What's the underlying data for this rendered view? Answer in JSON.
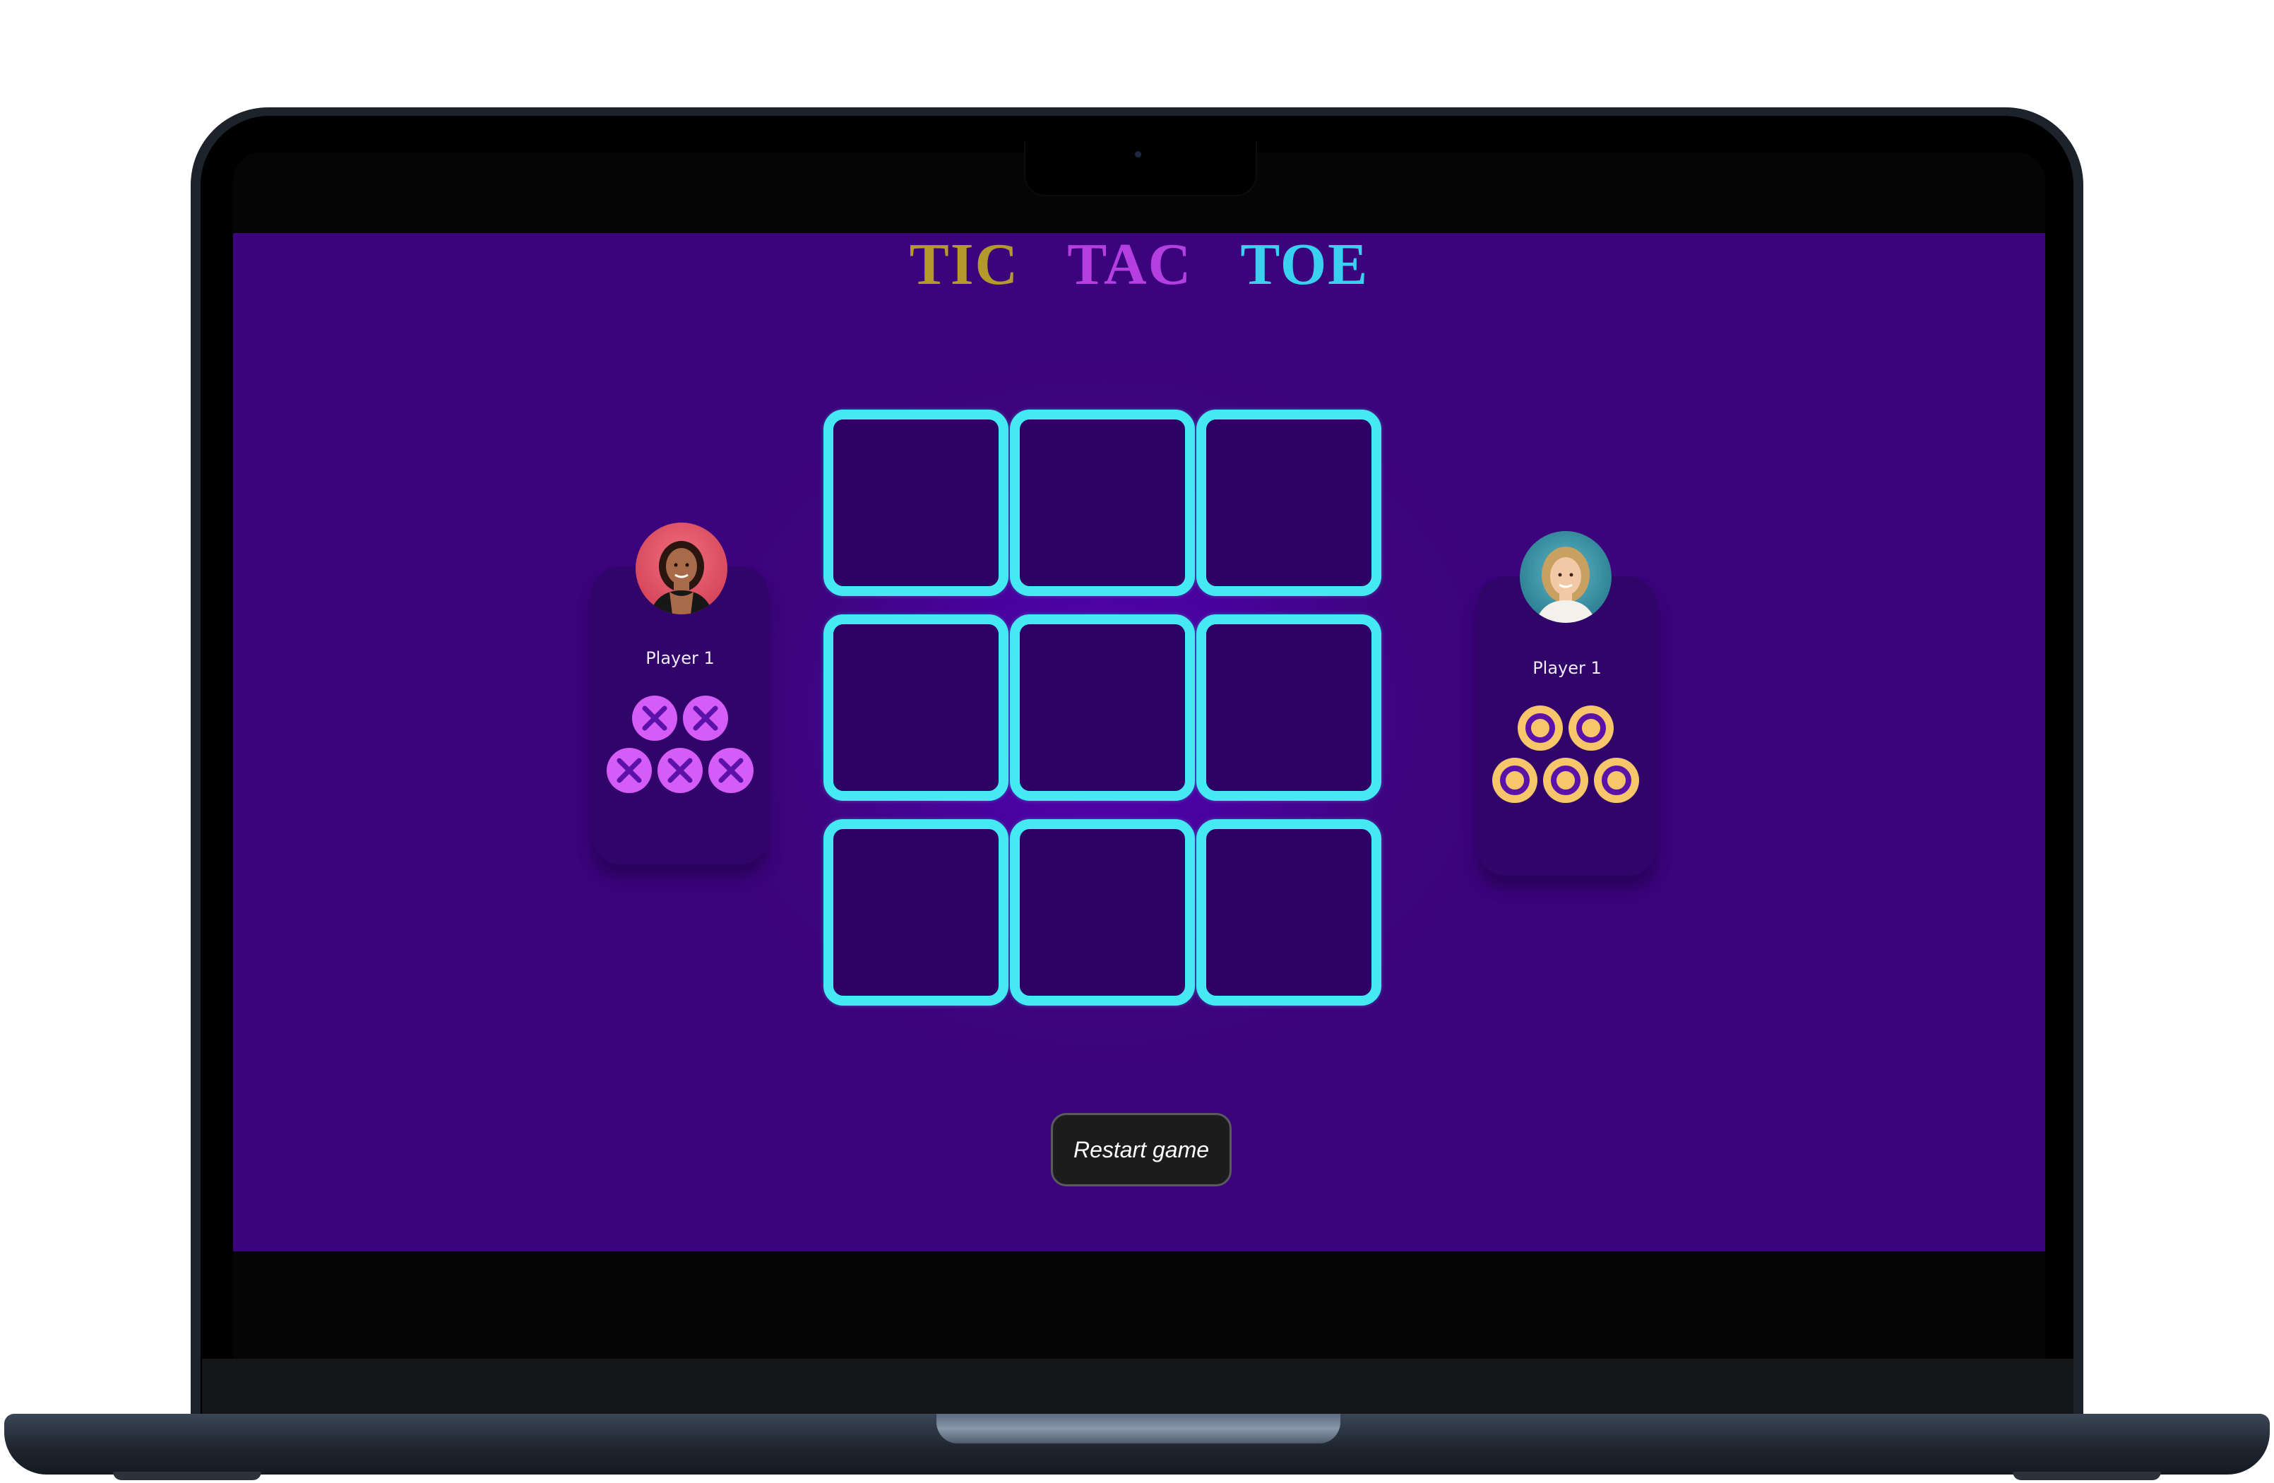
{
  "title": {
    "word1": "TIC",
    "word2": "TAC",
    "word3": "TOE"
  },
  "board": {
    "cells": [
      "",
      "",
      "",
      "",
      "",
      "",
      "",
      "",
      ""
    ]
  },
  "players": [
    {
      "name": "Player 1",
      "symbol": "X",
      "pieces_remaining": 5,
      "avatar": "avatar-photo"
    },
    {
      "name": "Player 1",
      "symbol": "O",
      "pieces_remaining": 5,
      "avatar": "avatar-photo"
    }
  ],
  "restart_label": "Restart game",
  "colors": {
    "background": "#3e047e",
    "cell_border": "#44e9f4",
    "cell_fill": "#2e0264",
    "x_piece": "#d55cf6",
    "o_piece": "#f7c66a",
    "title_tic": "#b49a2a",
    "title_tac": "#b43ee0",
    "title_toe": "#3ad0f0"
  }
}
